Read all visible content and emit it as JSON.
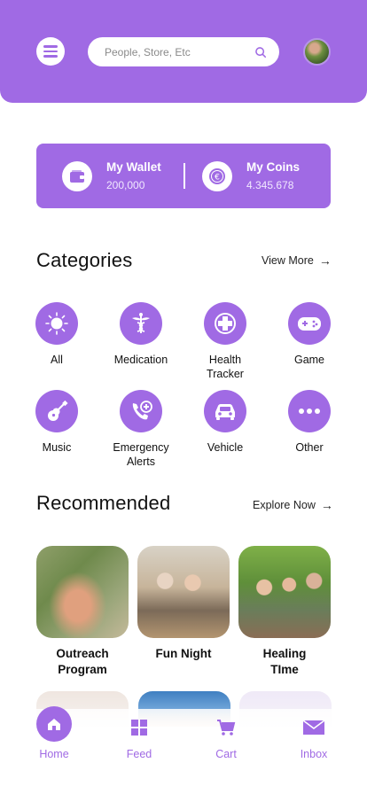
{
  "header": {
    "search_placeholder": "People, Store, Etc",
    "menu_icon": "hamburger-menu-icon",
    "search_icon": "search-icon",
    "avatar_icon": "user-avatar"
  },
  "wallet": {
    "wallet_title": "My Wallet",
    "wallet_value": "200,000",
    "coins_title": "My Coins",
    "coins_value": "4.345.678"
  },
  "categories": {
    "title": "Categories",
    "view_more": "View More",
    "items": [
      {
        "label": "All",
        "icon": "sun-icon"
      },
      {
        "label": "Medication",
        "icon": "caduceus-icon"
      },
      {
        "label": "Health\nTracker",
        "icon": "medical-cross-icon"
      },
      {
        "label": "Game",
        "icon": "gamepad-icon"
      },
      {
        "label": "Music",
        "icon": "guitar-icon"
      },
      {
        "label": "Emergency\nAlerts",
        "icon": "phone-plus-icon"
      },
      {
        "label": "Vehicle",
        "icon": "car-icon"
      },
      {
        "label": "Other",
        "icon": "dots-icon"
      }
    ]
  },
  "recommended": {
    "title": "Recommended",
    "explore": "Explore Now",
    "items": [
      {
        "label": "Outreach\nProgram"
      },
      {
        "label": "Fun Night"
      },
      {
        "label": "Healing\nTIme"
      }
    ]
  },
  "nav": {
    "home": "Home",
    "feed": "Feed",
    "cart": "Cart",
    "inbox": "Inbox"
  },
  "colors": {
    "accent": "#a06ae4"
  }
}
